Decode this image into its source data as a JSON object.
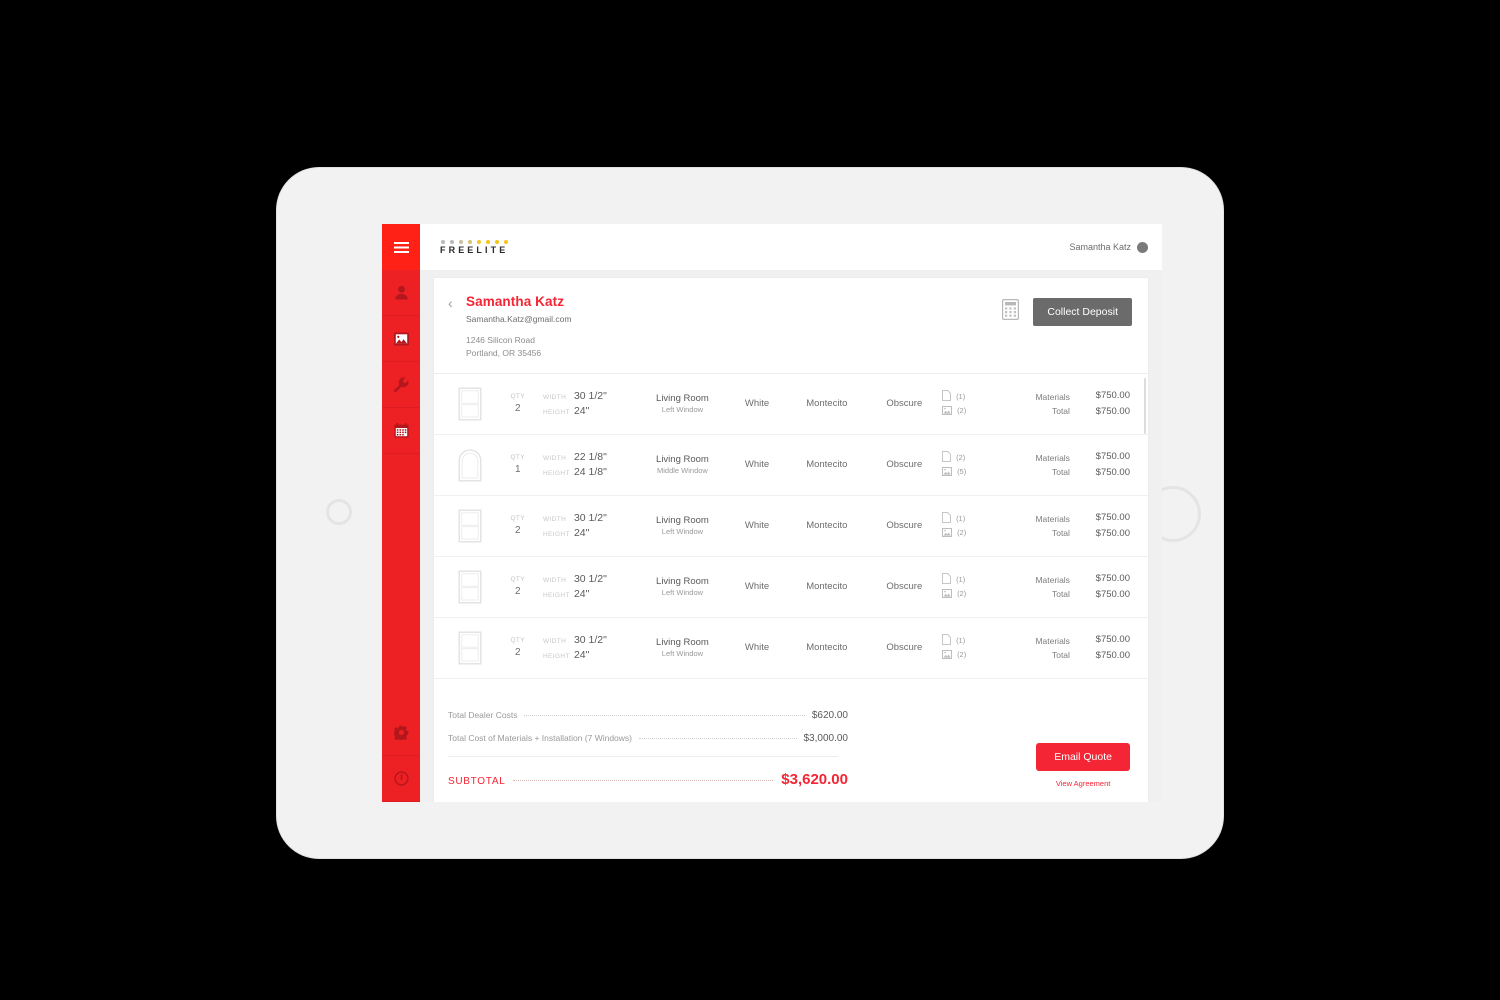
{
  "app": {
    "logo_word": "FREELITE",
    "logo_dot_colors": [
      "#b9b9b9",
      "#b9b9b9",
      "#c9c0a0",
      "#d8c474",
      "#f0c928",
      "#f5c518",
      "#f5c518",
      "#f5c518"
    ],
    "accent_red": "#f42534",
    "sidebar_red": "#ed2024",
    "dark_gray": "#6b6b6b"
  },
  "topbar": {
    "menu_icon": "hamburger-icon",
    "user_name": "Samantha Katz",
    "avatar_icon": "avatar-icon"
  },
  "sidebar": {
    "items": [
      {
        "icon": "hamburger-icon",
        "name": "menu-toggle",
        "active": true
      },
      {
        "icon": "person-icon",
        "name": "customers"
      },
      {
        "icon": "image-icon",
        "name": "gallery"
      },
      {
        "icon": "wrench-icon",
        "name": "tools"
      },
      {
        "icon": "calendar-icon",
        "name": "schedule"
      }
    ],
    "bottom_items": [
      {
        "icon": "gear-icon",
        "name": "settings"
      },
      {
        "icon": "power-icon",
        "name": "logout"
      }
    ]
  },
  "customer": {
    "back_icon": "chevron-left-icon",
    "name": "Samantha Katz",
    "email": "Samantha.Katz@gmail.com",
    "address_line1": "1246 Silicon Road",
    "address_line2": "Portland, OR 35456",
    "calculator_icon": "calculator-icon",
    "collect_deposit_label": "Collect Deposit"
  },
  "table": {
    "qty_label": "QTY",
    "width_label": "WIDTH",
    "height_label": "HEIGHT",
    "materials_label": "Materials",
    "total_label": "Total",
    "rows": [
      {
        "shape": "rect-window",
        "qty": "2",
        "width": "30 1/2\"",
        "height": "24\"",
        "room": "Living Room",
        "position": "Left Window",
        "color": "White",
        "style": "Montecito",
        "glass": "Obscure",
        "doc_count": "(1)",
        "img_count": "(2)",
        "materials_price": "$750.00",
        "total_price": "$750.00"
      },
      {
        "shape": "arch-window",
        "qty": "1",
        "width": "22 1/8\"",
        "height": "24 1/8\"",
        "room": "Living Room",
        "position": "Middle Window",
        "color": "White",
        "style": "Montecito",
        "glass": "Obscure",
        "doc_count": "(2)",
        "img_count": "(5)",
        "materials_price": "$750.00",
        "total_price": "$750.00"
      },
      {
        "shape": "rect-window",
        "qty": "2",
        "width": "30 1/2\"",
        "height": "24\"",
        "room": "Living Room",
        "position": "Left Window",
        "color": "White",
        "style": "Montecito",
        "glass": "Obscure",
        "doc_count": "(1)",
        "img_count": "(2)",
        "materials_price": "$750.00",
        "total_price": "$750.00"
      },
      {
        "shape": "rect-window",
        "qty": "2",
        "width": "30 1/2\"",
        "height": "24\"",
        "room": "Living Room",
        "position": "Left Window",
        "color": "White",
        "style": "Montecito",
        "glass": "Obscure",
        "doc_count": "(1)",
        "img_count": "(2)",
        "materials_price": "$750.00",
        "total_price": "$750.00"
      },
      {
        "shape": "rect-window",
        "qty": "2",
        "width": "30 1/2\"",
        "height": "24\"",
        "room": "Living Room",
        "position": "Left Window",
        "color": "White",
        "style": "Montecito",
        "glass": "Obscure",
        "doc_count": "(1)",
        "img_count": "(2)",
        "materials_price": "$750.00",
        "total_price": "$750.00"
      }
    ]
  },
  "totals": {
    "dealer_costs_label": "Total Dealer Costs",
    "dealer_costs_value": "$620.00",
    "materials_label": "Total Cost of Materials + Installation (7 Windows)",
    "materials_value": "$3,000.00",
    "subtotal_label": "SUBTOTAL",
    "subtotal_value": "$3,620.00"
  },
  "footer": {
    "email_quote_label": "Email Quote",
    "view_agreement_label": "View Agreement"
  }
}
